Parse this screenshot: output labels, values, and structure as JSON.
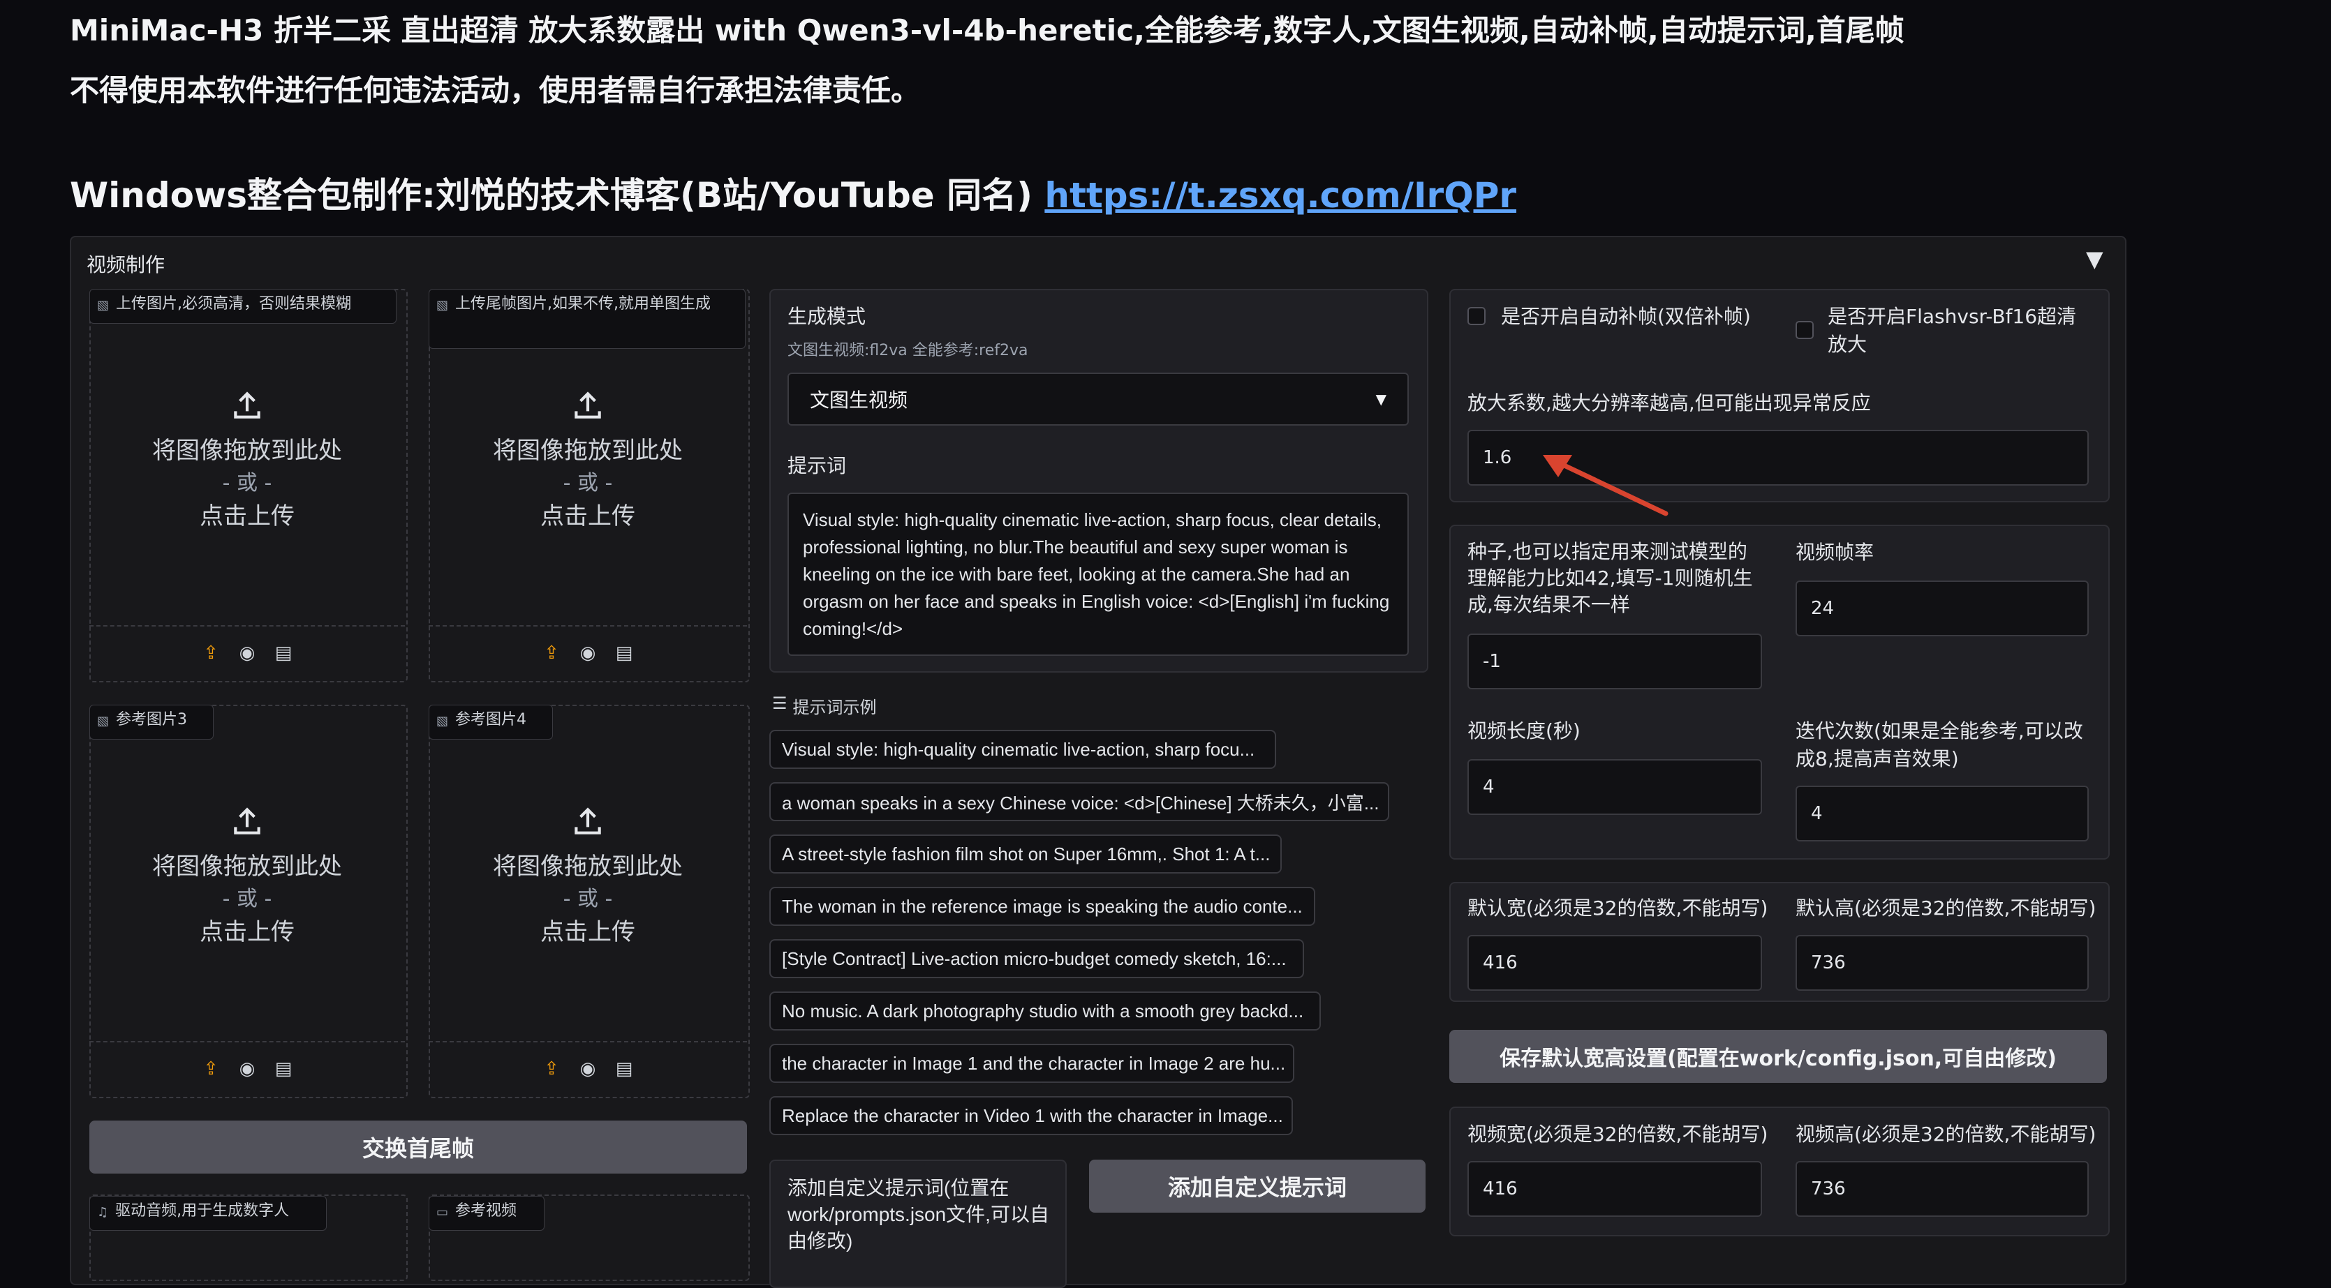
{
  "header": {
    "title_line": "MiniMac-H3 折半二采 直出超清 放大系数露出 with Qwen3-vl-4b-heretic,全能参考,数字人,文图生视频,自动补帧,自动提示词,首尾帧",
    "warning_line": "不得使用本软件进行任何违法活动，使用者需自行承担法律责任。",
    "author_text": "Windows整合包制作:刘悦的技术博客(B站/YouTube 同名) ",
    "author_link": "https://t.zsxq.com/IrQPr"
  },
  "accordion": {
    "title": "视频制作",
    "arrow": "▼"
  },
  "uploads": {
    "first_frame_label": "上传图片,必须高清，否则结果模糊",
    "last_frame_label": "上传尾帧图片,如果不传,就用单图生成",
    "ref3_label": "参考图片3",
    "ref4_label": "参考图片4",
    "drop_text": "将图像拖放到此处",
    "or_text": "- 或 -",
    "click_text": "点击上传",
    "audio_label": "驱动音频,用于生成数字人",
    "video_label": "参考视频"
  },
  "swap_button": "交换首尾帧",
  "generation": {
    "mode_label": "生成模式",
    "mode_hint": "文图生视频:fl2va 全能参考:ref2va",
    "mode_value": "文图生视频",
    "prompt_label": "提示词",
    "prompt_value": "Visual style: high-quality cinematic live-action, sharp focus, clear details, professional lighting, no blur.The beautiful and sexy super woman is kneeling on the ice with bare feet, looking at the camera.She had an orgasm on her face and speaks in English voice: <d>[English] i'm fucking coming!</d>",
    "examples_label": "提示词示例",
    "examples": [
      "Visual style: high-quality cinematic live-action, sharp focu...",
      "a woman speaks in a sexy Chinese voice: <d>[Chinese] 大桥未久，小富...",
      "A street-style fashion film shot on Super 16mm,. Shot 1: A t...",
      "The woman in the reference image is speaking the audio conte...",
      "[Style Contract] Live-action micro-budget comedy sketch, 16:...",
      "No music. A dark photography studio with a smooth grey backd...",
      "the character in Image 1 and the character in Image 2 are hu...",
      "Replace the character in Video 1 with the character in Image..."
    ],
    "custom_prompt_label": "添加自定义提示词(位置在work/prompts.json文件,可以自由修改)",
    "custom_prompt_button": "添加自定义提示词"
  },
  "settings": {
    "auto_interp_label": "是否开启自动补帧(双倍补帧)",
    "flashvsr_label": "是否开启Flashvsr-Bf16超清放大",
    "scale_label": "放大系数,越大分辨率越高,但可能出现异常反应",
    "scale_value": "1.6",
    "seed_label": "种子,也可以指定用来测试模型的理解能力比如42,填写-1则随机生成,每次结果不一样",
    "seed_value": "-1",
    "fps_label": "视频帧率",
    "fps_value": "24",
    "duration_label": "视频长度(秒)",
    "duration_value": "4",
    "iterations_label": "迭代次数(如果是全能参考,可以改成8,提高声音效果)",
    "iterations_value": "4",
    "default_width_label": "默认宽(必须是32的倍数,不能胡写)",
    "default_width_value": "416",
    "default_height_label": "默认高(必须是32的倍数,不能胡写)",
    "default_height_value": "736",
    "save_button": "保存默认宽高设置(配置在work/config.json,可自由修改)",
    "video_width_label": "视频宽(必须是32的倍数,不能胡写)",
    "video_width_value": "416",
    "video_height_label": "视频高(必须是32的倍数,不能胡写)",
    "video_height_value": "736"
  },
  "colors": {
    "background": "#0b0b0f",
    "panel": "#1f1f24",
    "link": "#60a5fa",
    "accent_orange": "#f59e0b",
    "arrow_red": "#d9442f"
  }
}
